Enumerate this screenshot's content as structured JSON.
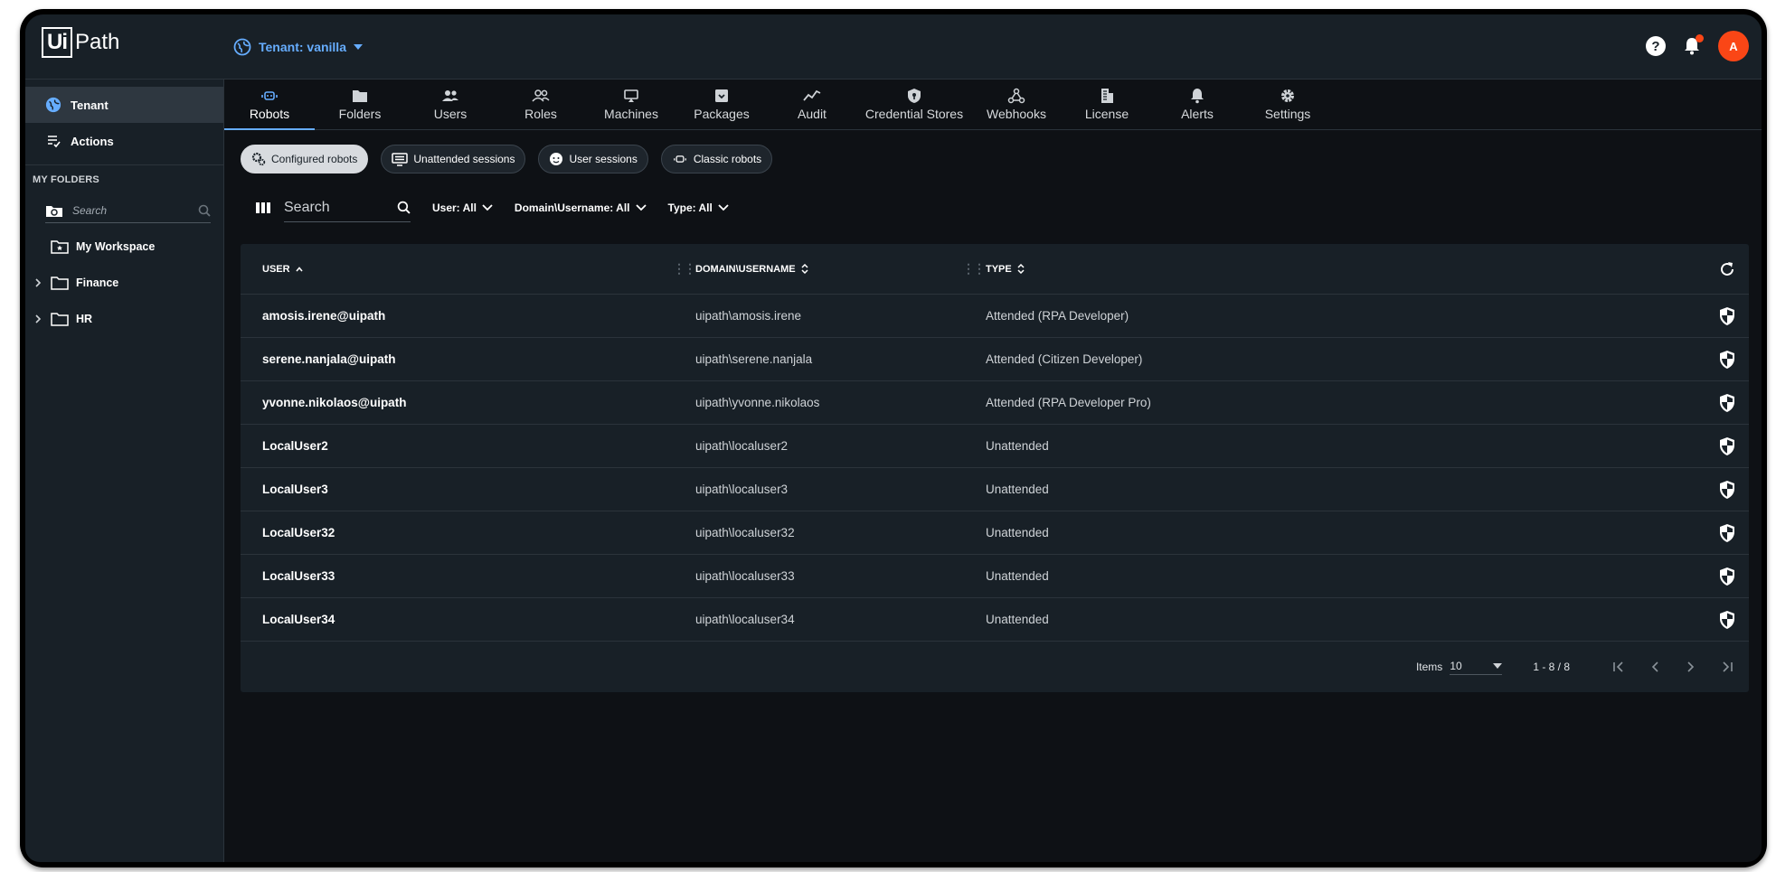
{
  "header": {
    "logo_box": "Ui",
    "logo_text": "Path",
    "tenant_label": "Tenant: vanilla",
    "help_glyph": "?",
    "avatar_initial": "A",
    "accent_color": "#66adff",
    "notification_color": "#fa4616"
  },
  "sidebar": {
    "items": [
      {
        "label": "Tenant",
        "icon": "globe-icon"
      },
      {
        "label": "Actions",
        "icon": "actions-list-icon"
      }
    ],
    "section_title": "MY FOLDERS",
    "search_placeholder": "Search",
    "folders": [
      {
        "label": "My Workspace",
        "icon": "workspace-folder-icon"
      },
      {
        "label": "Finance",
        "icon": "folder-icon"
      },
      {
        "label": "HR",
        "icon": "folder-icon"
      }
    ]
  },
  "tabs": [
    {
      "label": "Robots",
      "icon": "robot-icon"
    },
    {
      "label": "Folders",
      "icon": "folder-icon"
    },
    {
      "label": "Users",
      "icon": "users-icon"
    },
    {
      "label": "Roles",
      "icon": "roles-icon"
    },
    {
      "label": "Machines",
      "icon": "monitor-icon"
    },
    {
      "label": "Packages",
      "icon": "package-icon"
    },
    {
      "label": "Audit",
      "icon": "audit-chart-icon"
    },
    {
      "label": "Credential Stores",
      "icon": "shield-icon"
    },
    {
      "label": "Webhooks",
      "icon": "webhook-icon"
    },
    {
      "label": "License",
      "icon": "building-icon"
    },
    {
      "label": "Alerts",
      "icon": "bell-icon"
    },
    {
      "label": "Settings",
      "icon": "gear-icon"
    }
  ],
  "chips": [
    {
      "label": "Configured robots",
      "active": true
    },
    {
      "label": "Unattended sessions"
    },
    {
      "label": "User sessions"
    },
    {
      "label": "Classic robots"
    }
  ],
  "filters": {
    "search_placeholder": "Search",
    "user": "User: All",
    "domain": "Domain\\Username: All",
    "type": "Type: All"
  },
  "grid": {
    "columns": {
      "user": "USER",
      "domain": "DOMAIN\\USERNAME",
      "type": "TYPE"
    },
    "rows": [
      {
        "user": "amosis.irene@uipath",
        "domain": "uipath\\amosis.irene",
        "type": "Attended (RPA Developer)"
      },
      {
        "user": "serene.nanjala@uipath",
        "domain": "uipath\\serene.nanjala",
        "type": "Attended (Citizen Developer)"
      },
      {
        "user": "yvonne.nikolaos@uipath",
        "domain": "uipath\\yvonne.nikolaos",
        "type": "Attended (RPA Developer Pro)"
      },
      {
        "user": "LocalUser2",
        "domain": "uipath\\localuser2",
        "type": "Unattended"
      },
      {
        "user": "LocalUser3",
        "domain": "uipath\\localuser3",
        "type": "Unattended"
      },
      {
        "user": "LocalUser32",
        "domain": "uipath\\localuser32",
        "type": "Unattended"
      },
      {
        "user": "LocalUser33",
        "domain": "uipath\\localuser33",
        "type": "Unattended"
      },
      {
        "user": "LocalUser34",
        "domain": "uipath\\localuser34",
        "type": "Unattended"
      }
    ],
    "pager": {
      "items_label": "Items",
      "items_value": "10",
      "range": "1 - 8 / 8"
    }
  }
}
